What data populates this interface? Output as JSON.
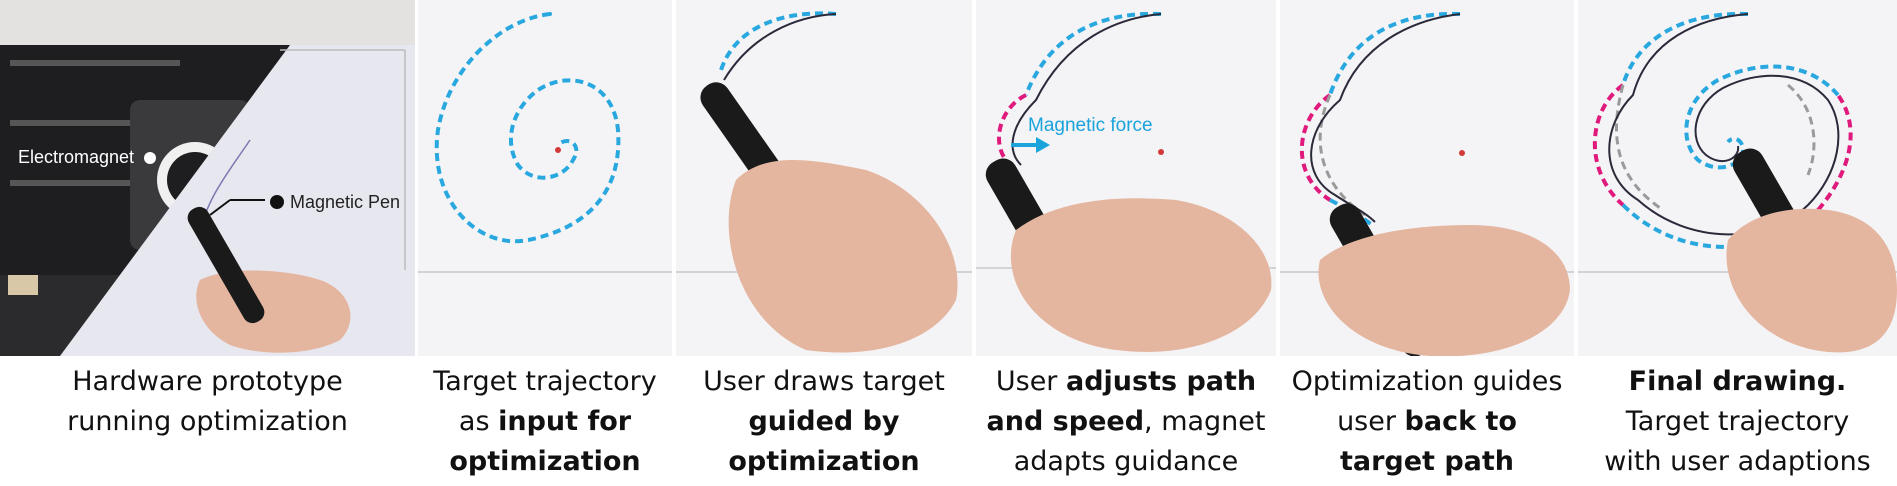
{
  "colors": {
    "target_path": "#29a8e0",
    "adapted_path": "#e0197d",
    "previous_path": "#9a9a9a",
    "drawn_line": "#2a2a3a",
    "magnet_dot": "#d23a3a",
    "paper": "#f4f4f6"
  },
  "panels": [
    {
      "labels": {
        "electromagnet": "Electromagnet",
        "pen": "Magnetic Pen"
      },
      "caption": {
        "line1": "Hardware prototype",
        "line2": "running optimization"
      }
    },
    {
      "caption": {
        "line1": "Target trajectory",
        "line2a": "as ",
        "line2b": "input for",
        "line3": "optimization"
      }
    },
    {
      "caption": {
        "line1": "User draws target",
        "line2": "guided by",
        "line3": "optimization"
      }
    },
    {
      "annotation": "Magnetic force",
      "caption": {
        "line1a": "User ",
        "line1b": "adjusts path",
        "line2a": "and speed",
        "line2b": ", magnet",
        "line3": "adapts guidance"
      }
    },
    {
      "caption": {
        "line1": "Optimization guides",
        "line2a": "user ",
        "line2b": "back to",
        "line3": "target path"
      }
    },
    {
      "caption": {
        "line1": "Final drawing.",
        "line2": "Target trajectory",
        "line3": "with user adaptions"
      }
    }
  ]
}
